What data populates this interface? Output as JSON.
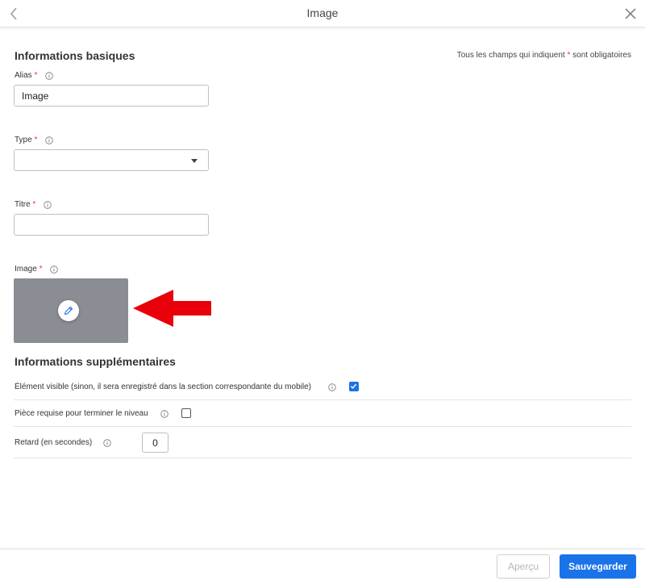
{
  "header": {
    "title": "Image",
    "back_icon": "chevron-left-icon",
    "close_icon": "close-icon"
  },
  "basic": {
    "section_title": "Informations basiques",
    "required_note_prefix": "Tous les champs qui indiquent ",
    "required_note_star": "*",
    "required_note_suffix": " sont obligatoires",
    "alias": {
      "label": "Alias",
      "star": "*",
      "value": "Image"
    },
    "type": {
      "label": "Type",
      "star": "*",
      "value": ""
    },
    "titre": {
      "label": "Titre",
      "star": "*",
      "value": ""
    },
    "image": {
      "label": "Image",
      "star": "*",
      "edit_icon": "pencil-icon"
    }
  },
  "extra": {
    "section_title": "Informations supplémentaires",
    "visible": {
      "label": "Élément visible (sinon, il sera enregistré dans la section correspondante du mobile)",
      "checked": true
    },
    "required_piece": {
      "label": "Pièce requise pour terminer le niveau",
      "checked": false
    },
    "delay": {
      "label": "Retard (en secondes)",
      "value": "0"
    }
  },
  "footer": {
    "preview_label": "Aperçu",
    "save_label": "Sauvegarder"
  },
  "colors": {
    "accent": "#1a73e8",
    "required": "#e53935",
    "image_placeholder": "#8a8d93",
    "annotation_arrow": "#e8000b"
  }
}
